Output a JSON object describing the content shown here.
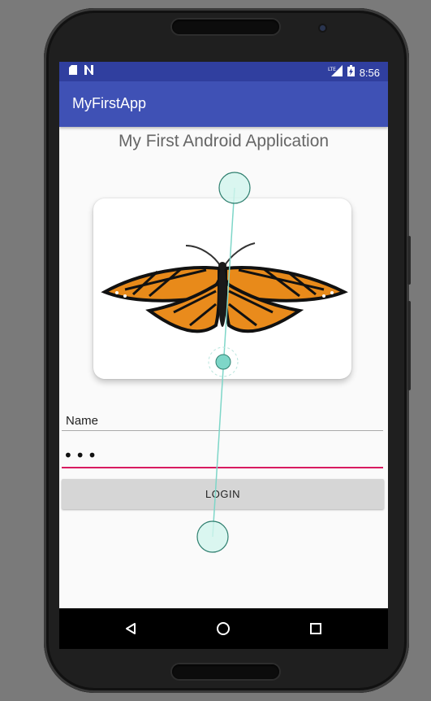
{
  "status_bar": {
    "time": "8:56",
    "icons": [
      "sd-card-icon",
      "notification-n-icon",
      "lte-signal-icon",
      "battery-icon"
    ],
    "background": "#303f9f"
  },
  "app_bar": {
    "title": "MyFirstApp",
    "background": "#3f51b5"
  },
  "main": {
    "heading": "My First Android Application",
    "image": {
      "name": "butterfly-image",
      "subject": "monarch butterfly"
    },
    "name_label": "Name",
    "password_value": "•••",
    "login_label": "LOGIN"
  },
  "nav_bar": {
    "icons": [
      "back-triangle-icon",
      "home-circle-icon",
      "recents-square-icon"
    ]
  },
  "gesture_overlay": {
    "description": "touch gesture indicators",
    "color": "#7ed6c8"
  },
  "colors": {
    "accent": "#d81b60",
    "primary": "#3f51b5",
    "primary_dark": "#303f9f"
  }
}
